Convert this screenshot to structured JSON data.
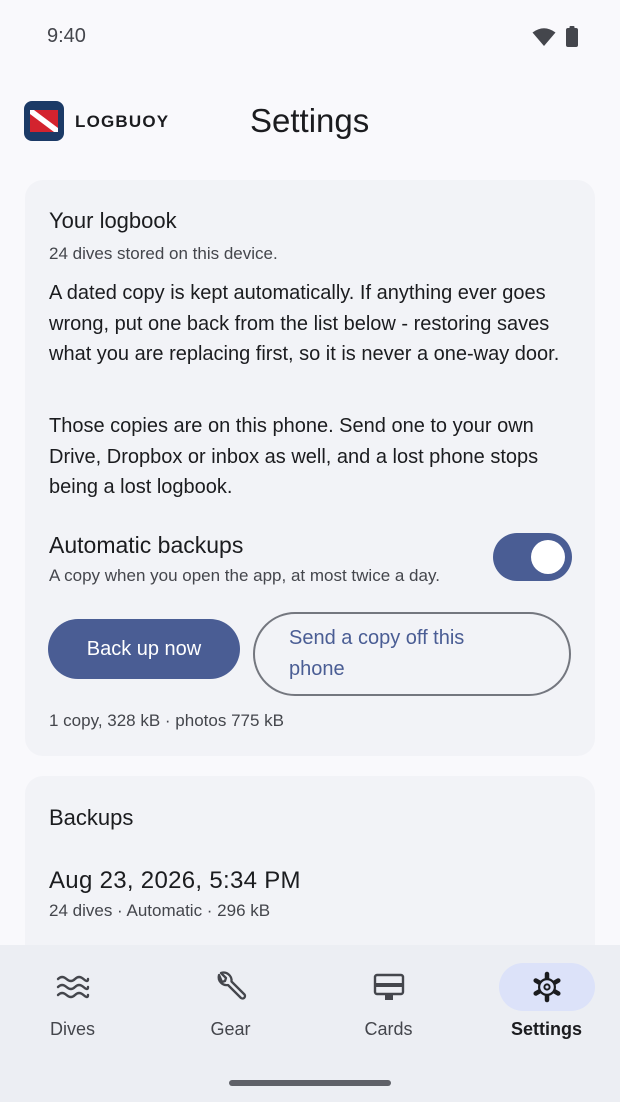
{
  "status": {
    "time": "9:40"
  },
  "header": {
    "app_name": "LOGBUOY",
    "title": "Settings"
  },
  "logbook": {
    "title": "Your logbook",
    "subtitle": "24 dives stored on this device.",
    "para1": "A dated copy is kept automatically. If anything ever goes wrong, put one back from the list below - restoring saves what you are replacing first, so it is never a one-way door.",
    "para2": "Those copies are on this phone. Send one to your own Drive, Dropbox or inbox as well, and a lost phone stops being a lost logbook.",
    "auto_backup": {
      "label": "Automatic backups",
      "description": "A copy when you open the app, at most twice a day.",
      "enabled": true
    },
    "backup_now_label": "Back up now",
    "send_copy_label": "Send a copy off this phone",
    "stats": "1 copy, 328 kB · photos 775 kB"
  },
  "backups": {
    "title": "Backups",
    "items": [
      {
        "date": "Aug 23, 2026, 5:34 PM",
        "meta": "24 dives · Automatic · 296 kB"
      }
    ]
  },
  "nav": {
    "items": [
      {
        "label": "Dives",
        "icon": "waves-icon"
      },
      {
        "label": "Gear",
        "icon": "wrench-icon"
      },
      {
        "label": "Cards",
        "icon": "card-icon"
      },
      {
        "label": "Settings",
        "icon": "gear-icon",
        "active": true
      }
    ]
  },
  "colors": {
    "primary": "#4a5d94",
    "background": "#f9f9fc",
    "card": "#f2f3f7",
    "nav_background": "#eceef3",
    "active_pill": "#dce2f9",
    "logo_red": "#d3232e",
    "logo_navy": "#1b3a66"
  }
}
